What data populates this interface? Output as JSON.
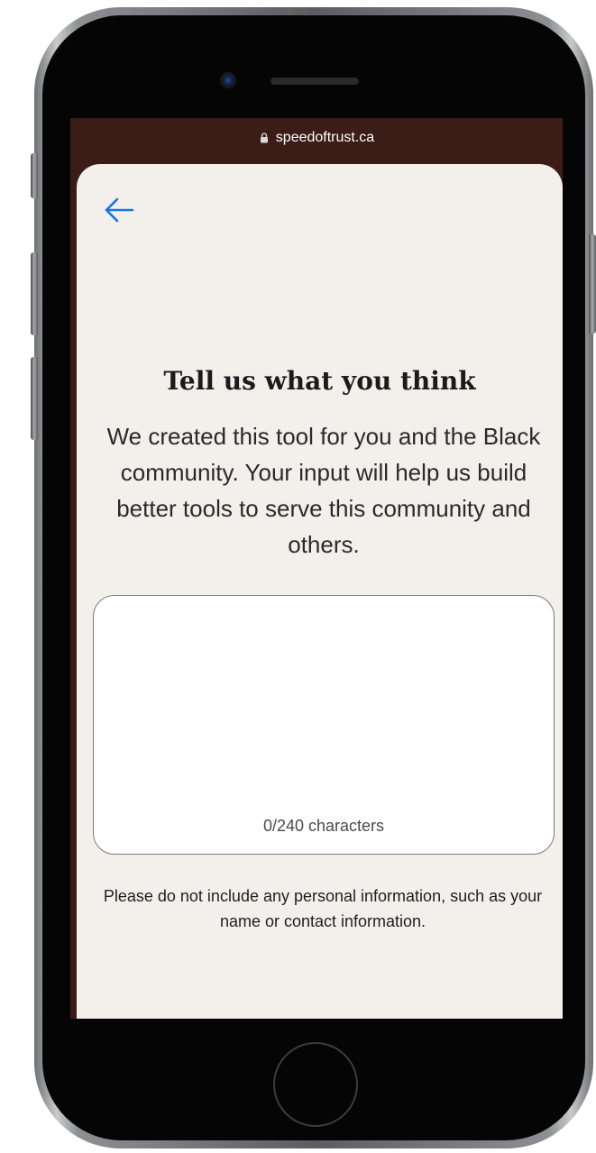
{
  "browser": {
    "url": "speedoftrust.ca"
  },
  "page": {
    "title": "Tell us what you think",
    "description": "We created this tool for you and the Black community. Your input will help us build better tools to serve this community and others.",
    "feedback": {
      "value": "",
      "counter": "0/240 characters"
    },
    "disclaimer": "Please do not include any personal information, such as your name or contact information."
  },
  "icons": {
    "back": "back-arrow-icon",
    "lock": "lock-icon"
  },
  "colors": {
    "header_bg": "#3c1c17",
    "sheet_bg": "#f3f0eb",
    "accent": "#1a73e8",
    "text": "#1b1b1b"
  }
}
